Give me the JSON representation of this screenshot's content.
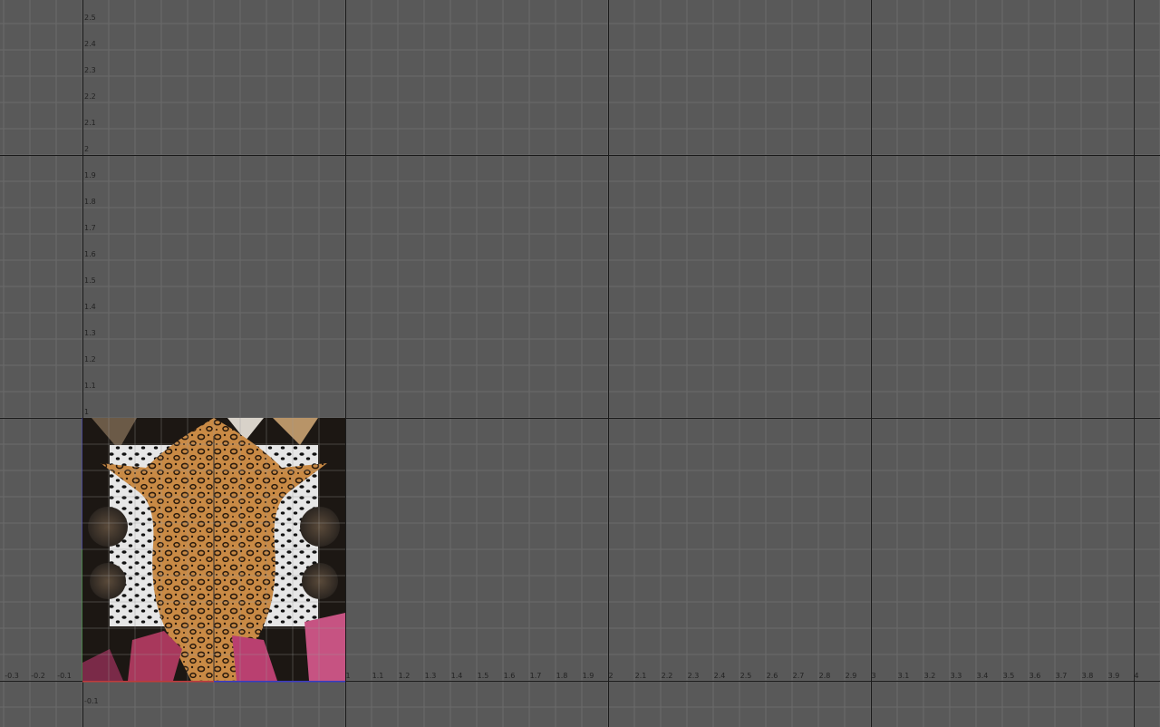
{
  "viewport": {
    "u_axis_labels": [
      "-0.3",
      "-0.2",
      "-0.1",
      "1",
      "1.1",
      "1.2",
      "1.3",
      "1.4",
      "1.5",
      "1.6",
      "1.7",
      "1.8",
      "1.9",
      "2",
      "2.1",
      "2.2",
      "2.3",
      "2.4",
      "2.5",
      "2.6",
      "2.7",
      "2.8",
      "2.9",
      "3",
      "3.1",
      "3.2",
      "3.3",
      "3.4",
      "3.5",
      "3.6",
      "3.7",
      "3.8",
      "3.9",
      "4"
    ],
    "v_axis_labels": [
      "2.5",
      "2.4",
      "2.3",
      "2.2",
      "2.1",
      "2",
      "1.9",
      "1.8",
      "1.7",
      "1.6",
      "1.5",
      "1.4",
      "1.3",
      "1.2",
      "1.1",
      "1",
      "-0.1"
    ],
    "colors": {
      "background": "#595959",
      "minor_grid": "#6a6a6a",
      "major_grid": "#1a1a1a",
      "axis_u": "#c23a3a",
      "axis_v_green": "#3aa53a",
      "axis_v_blue": "#3a3ac2"
    }
  },
  "texture": {
    "name": "leopard-skin-texture",
    "u_range": [
      0,
      1
    ],
    "v_range": [
      0,
      1
    ]
  }
}
